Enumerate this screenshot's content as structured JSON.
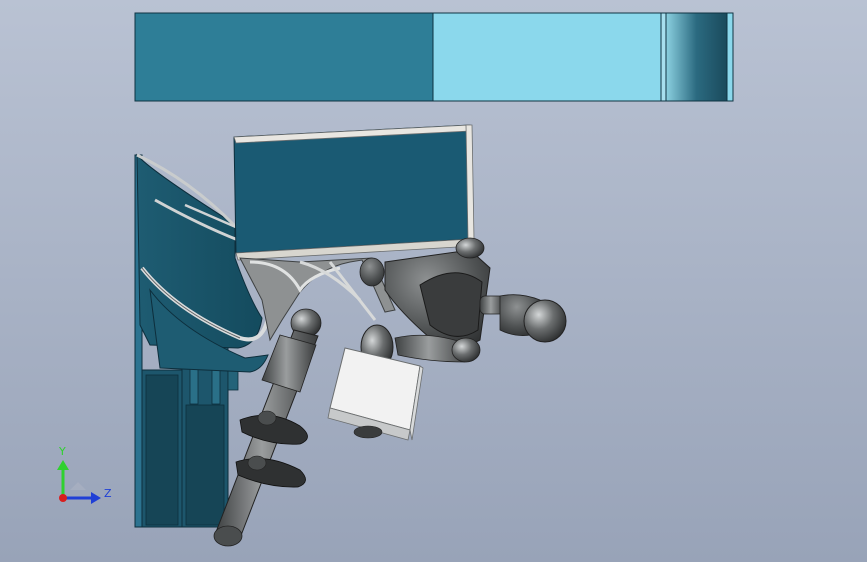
{
  "viewport": {
    "background_top": "#b9c2d3",
    "background_bottom": "#98a3b8"
  },
  "triad": {
    "y_label": "Y",
    "z_label": "Z",
    "y_color": "#2fd12f",
    "z_color": "#1f3fd6",
    "x_color": "#d81e1e"
  },
  "model": {
    "panel_dark": "#1a5a73",
    "panel_mid": "#2e7e97",
    "panel_light": "#8bd8ec",
    "metal": "#5e6162",
    "metal_highlight": "#c9cccd",
    "block": "#f2f2f2"
  }
}
